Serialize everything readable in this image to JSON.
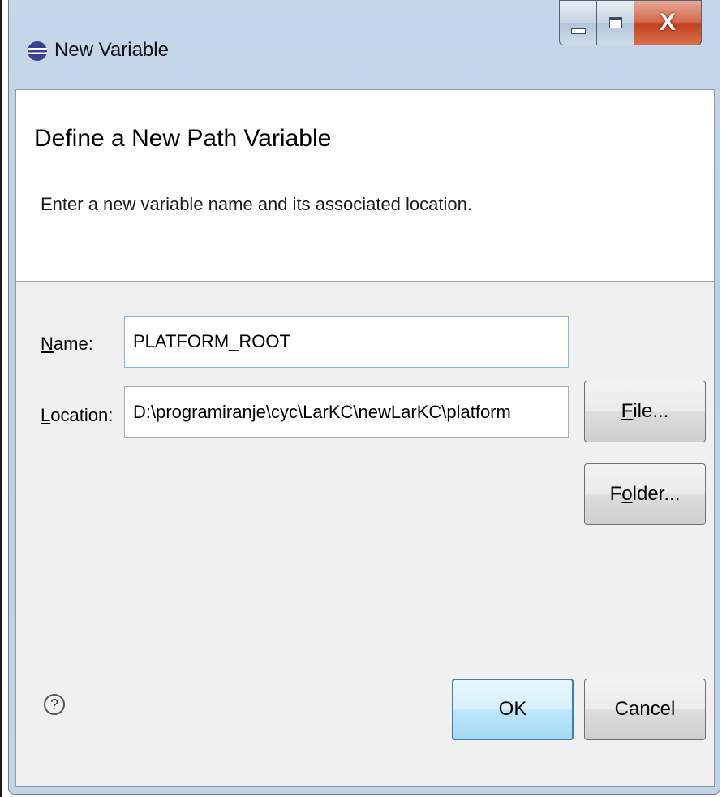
{
  "window": {
    "title": "New Variable",
    "icon": "eclipse-icon",
    "close_glyph": "X"
  },
  "banner": {
    "title": "Define a New Path Variable",
    "description": "Enter a new variable name and its associated location."
  },
  "form": {
    "name_label_mnemonic": "N",
    "name_label_rest": "ame:",
    "name_value": "PLATFORM_ROOT",
    "location_label_mnemonic": "L",
    "location_label_rest": "ocation:",
    "location_value": "D:\\programiranje\\cyc\\LarKC\\newLarKC\\platform"
  },
  "buttons": {
    "file_mnemonic": "F",
    "file_rest": "ile...",
    "folder_pre": "F",
    "folder_mnemonic": "o",
    "folder_rest": "lder...",
    "ok": "OK",
    "cancel": "Cancel"
  },
  "help": {
    "glyph": "?"
  },
  "colors": {
    "close_button": "#c2401f",
    "default_button_border": "#3c7fb1",
    "dialog_background": "#f0f0f0"
  }
}
